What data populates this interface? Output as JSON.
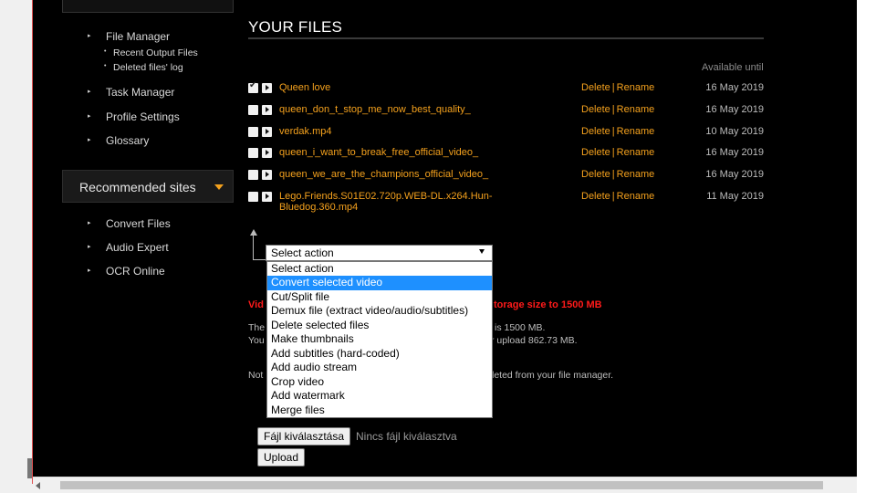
{
  "sidebar": {
    "nav": [
      {
        "label": "File Manager"
      },
      {
        "label": "Task Manager"
      },
      {
        "label": "Profile Settings"
      },
      {
        "label": "Glossary"
      }
    ],
    "file_manager_sub": [
      {
        "label": "Recent Output Files"
      },
      {
        "label": "Deleted files' log"
      }
    ],
    "recommended": {
      "title": "Recommended sites",
      "items": [
        {
          "label": "Convert Files"
        },
        {
          "label": "Audio Expert"
        },
        {
          "label": "OCR Online"
        }
      ]
    }
  },
  "main": {
    "title": "YOUR FILES",
    "available_header": "Available until",
    "action_delete": "Delete",
    "action_sep": "|",
    "action_rename": "Rename",
    "files": [
      {
        "name": "Queen love",
        "date": "16 May 2019",
        "checked": true
      },
      {
        "name": "queen_don_t_stop_me_now_best_quality_",
        "date": "16 May 2019",
        "checked": false
      },
      {
        "name": "verdak.mp4",
        "date": "10 May 2019",
        "checked": false
      },
      {
        "name": "queen_i_want_to_break_free_official_video_",
        "date": "16 May 2019",
        "checked": false
      },
      {
        "name": "queen_we_are_the_champions_official_video_",
        "date": "16 May 2019",
        "checked": false
      },
      {
        "name": "Lego.Friends.S01E02.720p.WEB-DL.x264.Hun-Bluedog.360.mp4",
        "date": "11 May 2019",
        "checked": false
      }
    ],
    "select": {
      "value": "Select action",
      "options": [
        "Select action",
        "Convert selected video",
        "Cut/Split file",
        "Demux file (extract video/audio/subtitles)",
        "Delete selected files",
        "Make thumbnails",
        "Add subtitles (hard-coded)",
        "Add audio stream",
        "Crop video",
        "Add watermark",
        "Merge files"
      ],
      "highlighted_index": 1
    },
    "promo_left": "Vid",
    "promo_right": "torage size to 1500 MB",
    "info_frag_1a": "The",
    "info_frag_1b": "is 1500 MB.",
    "info_frag_2a": "You",
    "info_frag_2b": "r upload 862.73 MB.",
    "note_frag_a": "Not",
    "note_frag_b": "leted from your file manager.",
    "choose_file_button": "Fájl kiválasztása",
    "no_file_text": "Nincs fájl kiválasztva",
    "upload_button": "Upload"
  },
  "colors": {
    "accent": "#f4a11d",
    "promo": "#ff1a1a",
    "highlight": "#1e90ff"
  }
}
